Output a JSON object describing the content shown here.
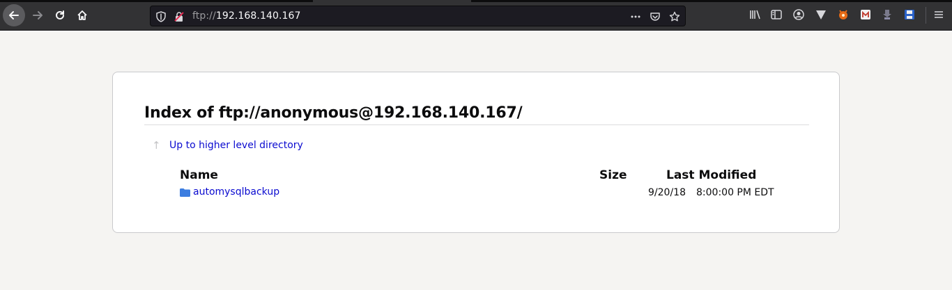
{
  "browser": {
    "url_scheme": "ftp://",
    "url_host": "192.168.140.167",
    "icons": {
      "back": "back-arrow-icon",
      "forward": "forward-arrow-icon",
      "reload": "reload-icon",
      "home": "home-icon",
      "tracking": "shield-icon",
      "insecure": "insecure-lock-icon",
      "page_actions": "more-dots-icon",
      "pocket": "pocket-icon",
      "bookmark": "star-icon",
      "library": "library-icon",
      "sidebar": "sidebar-icon",
      "account": "account-icon",
      "ext1": "vpn-shield-icon",
      "ext2": "foxyproxy-icon",
      "ext3": "wappalyzer-icon",
      "ext4": "cookie-editor-icon",
      "ext5": "save-icon",
      "menu": "hamburger-menu-icon"
    }
  },
  "page": {
    "title": "Index of ftp://anonymous@192.168.140.167/",
    "up_link": "Up to higher level directory",
    "columns": {
      "name": "Name",
      "size": "Size",
      "modified": "Last Modified"
    },
    "rows": [
      {
        "name": "automysqlbackup",
        "size": "",
        "date": "9/20/18",
        "time": "8:00:00 PM EDT"
      }
    ]
  },
  "colors": {
    "toolbar_bg": "#323234",
    "urlbar_bg": "#1c1b22",
    "link": "#0a0ad0",
    "folder": "#3c7de0",
    "page_bg": "#f5f4f2"
  }
}
